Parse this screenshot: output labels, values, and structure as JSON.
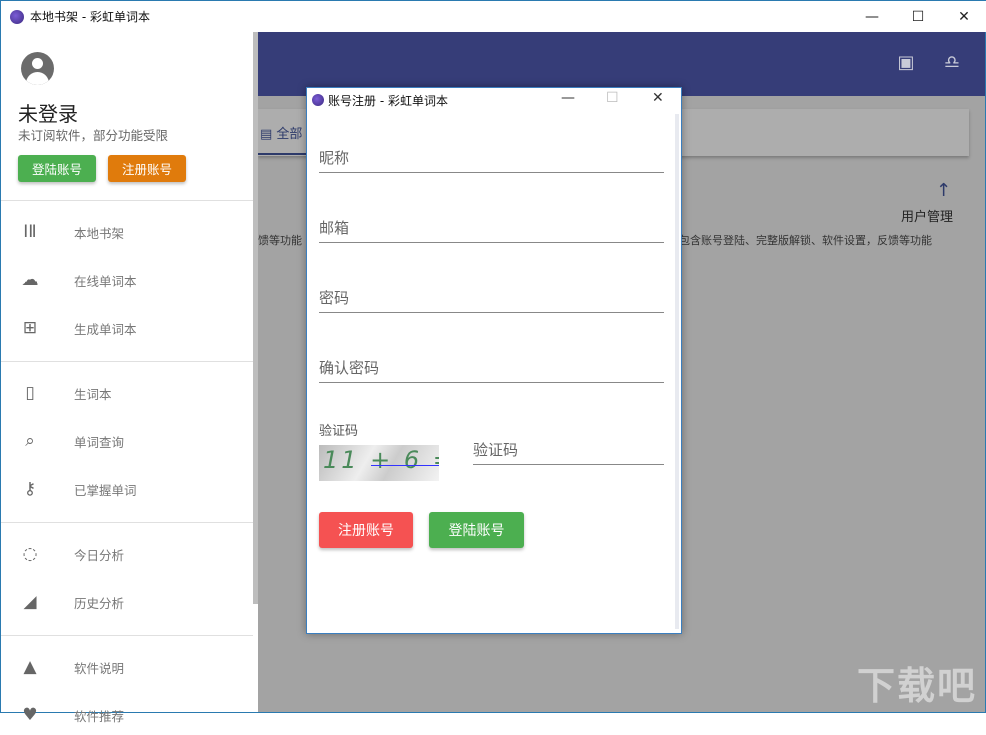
{
  "window": {
    "title": "本地书架 - 彩虹单词本",
    "minimize": "—",
    "maximize": "☐",
    "close": "✕"
  },
  "header": {
    "icons": [
      "book-search-icon",
      "bell-icon"
    ]
  },
  "tabs": {
    "all": "全部"
  },
  "content": {
    "user_mgmt_title": "用户管理",
    "desc_left": "馈等功能",
    "desc_right": "包含账号登陆、完整版解锁、软件设置，反馈等功能"
  },
  "sidebar": {
    "user_name": "未登录",
    "user_sub": "未订阅软件，部分功能受限",
    "login_btn": "登陆账号",
    "register_btn": "注册账号",
    "items": [
      {
        "label": "本地书架",
        "icon": "library-icon"
      },
      {
        "label": "在线单词本",
        "icon": "cloud-icon"
      },
      {
        "label": "生成单词本",
        "icon": "add-bookmark-icon"
      },
      {
        "label": "生词本",
        "icon": "book-icon"
      },
      {
        "label": "单词查询",
        "icon": "search-doc-icon"
      },
      {
        "label": "已掌握单词",
        "icon": "key-icon"
      },
      {
        "label": "今日分析",
        "icon": "donut-icon"
      },
      {
        "label": "历史分析",
        "icon": "area-chart-icon"
      },
      {
        "label": "软件说明",
        "icon": "mountain-icon"
      },
      {
        "label": "软件推荐",
        "icon": "heart-icon"
      }
    ]
  },
  "dialog": {
    "title": "账号注册 - 彩虹单词本",
    "minimize": "—",
    "maximize": "☐",
    "close": "✕",
    "nickname_placeholder": "昵称",
    "email_placeholder": "邮箱",
    "password_placeholder": "密码",
    "confirm_placeholder": "确认密码",
    "captcha_label": "验证码",
    "captcha_text": "11 + 6 =",
    "captcha_placeholder": "验证码",
    "register_btn": "注册账号",
    "login_btn": "登陆账号"
  },
  "watermark": "下载吧",
  "colors": {
    "header": "#363d78",
    "green": "#4caf50",
    "orange": "#e07b0c",
    "red": "#f55252"
  }
}
